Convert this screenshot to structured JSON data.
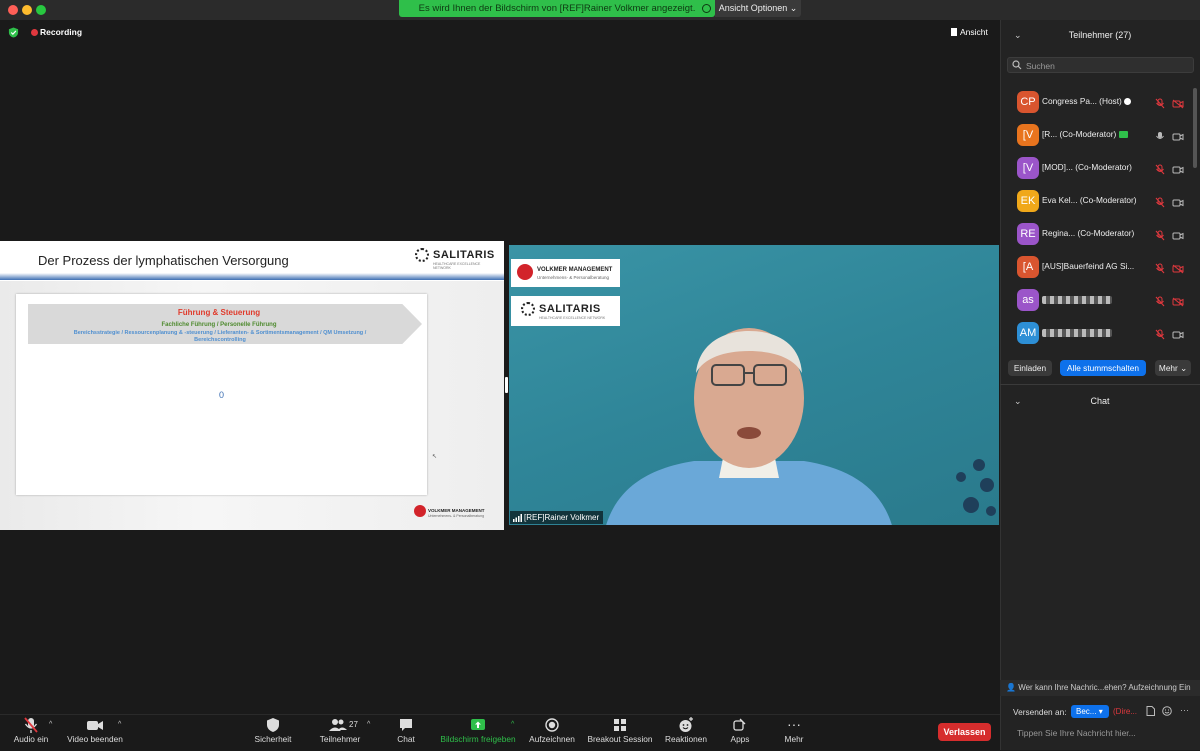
{
  "banner": {
    "share_text": "Es wird Ihnen der Bildschirm von [REF]Rainer Volkmer angezeigt.",
    "view_options": "Ansicht Optionen ⌄"
  },
  "stage": {
    "recording_label": "Recording",
    "view_label": "Ansicht"
  },
  "slide": {
    "title": "Der Prozess der lymphatischen Versorgung",
    "logo_name": "SALITARIS",
    "logo_sub": "HEALTHCARE EXCELLENCE NETWORK",
    "heading": "Führung & Steuerung",
    "subheading": "Fachliche Führung / Personelle Führung",
    "detail": "Bereichsstrategie / Ressourcenplanung & -steuerung / Lieferanten- & Sortimentsmanagement / QM Umsetzung / Bereichscontrolling",
    "number": "0",
    "footer_logo": "VOLKMER MANAGEMENT",
    "footer_logo_sub": "Unternehmens- & Personalberatung"
  },
  "video": {
    "logo1": "VOLKMER MANAGEMENT",
    "logo1_sub": "Unternehmens- & Personalberatung",
    "logo2": "SALITARIS",
    "logo2_sub": "HEALTHCARE EXCELLENCE NETWORK",
    "participant_name": "[REF]Rainer Volkmer"
  },
  "participants": {
    "header": "Teilnehmer (27)",
    "search_placeholder": "Suchen",
    "list": [
      {
        "initials": "CP",
        "color": "#d9552f",
        "name": "Congress Pa...  (Host)",
        "mic": "muted",
        "cam": "off"
      },
      {
        "initials": "[V",
        "color": "#e8741e",
        "name": "[R...   (Co-Moderator)",
        "mic": "on",
        "cam": "on"
      },
      {
        "initials": "[V",
        "color": "#9b55c9",
        "name": "[MOD]...  (Co-Moderator)",
        "mic": "muted",
        "cam": "on"
      },
      {
        "initials": "EK",
        "color": "#f0a81a",
        "name": "Eva Kel...  (Co-Moderator)",
        "mic": "muted",
        "cam": "on"
      },
      {
        "initials": "RE",
        "color": "#9b55c9",
        "name": "Regina...   (Co-Moderator)",
        "mic": "muted",
        "cam": "on"
      },
      {
        "initials": "[A",
        "color": "#d9552f",
        "name": "[AUS]Bauerfeind AG Si...",
        "mic": "muted",
        "cam": "off"
      },
      {
        "initials": "as",
        "color": "#9b55c9",
        "name": "",
        "mic": "muted",
        "cam": "off"
      },
      {
        "initials": "AM",
        "color": "#2d8fd6",
        "name": "",
        "mic": "muted",
        "cam": "on"
      }
    ],
    "invite_label": "Einladen",
    "mute_all_label": "Alle stummschalten",
    "more_label": "Mehr"
  },
  "chat": {
    "header": "Chat",
    "who_can_see": "Wer kann Ihre Nachric...ehen? Aufzeichnung Ein",
    "send_to_label": "Versenden an:",
    "send_to_value": "Bec...",
    "direct_label": "(Dire...",
    "input_placeholder": "Tippen Sie Ihre Nachricht hier..."
  },
  "toolbar": {
    "audio": "Audio ein",
    "video": "Video beenden",
    "security": "Sicherheit",
    "participants": "Teilnehmer",
    "participants_count": "27",
    "chat": "Chat",
    "share": "Bildschirm freigeben",
    "record": "Aufzeichnen",
    "breakout": "Breakout Session",
    "reactions": "Reaktionen",
    "apps": "Apps",
    "more": "Mehr",
    "leave": "Verlassen"
  },
  "colors": {
    "accent_blue": "#0e71eb",
    "share_green": "#2fbf4a",
    "leave_red": "#d62d2d",
    "recording_red": "#e0383e"
  }
}
